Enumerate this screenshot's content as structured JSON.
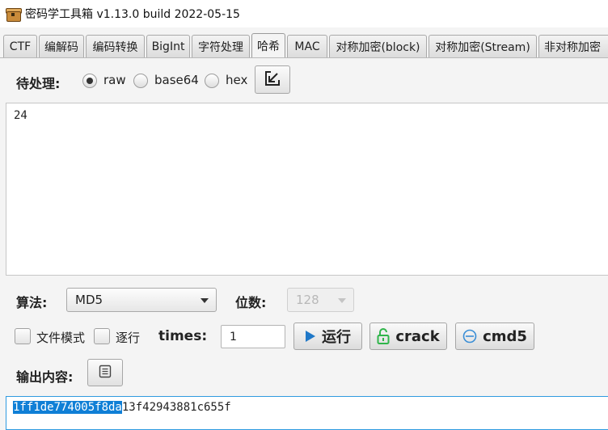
{
  "window": {
    "title": "密码学工具箱 v1.13.0 build 2022-05-15"
  },
  "tabs": [
    {
      "label": "CTF",
      "active": false
    },
    {
      "label": "编解码",
      "active": false
    },
    {
      "label": "编码转换",
      "active": false
    },
    {
      "label": "BigInt",
      "active": false
    },
    {
      "label": "字符处理",
      "active": false
    },
    {
      "label": "哈希",
      "active": true
    },
    {
      "label": "MAC",
      "active": false
    },
    {
      "label": "对称加密(block)",
      "active": false
    },
    {
      "label": "对称加密(Stream)",
      "active": false
    },
    {
      "label": "非对称加密",
      "active": false
    }
  ],
  "input": {
    "label": "待处理:",
    "encoding_options": [
      {
        "label": "raw",
        "checked": true
      },
      {
        "label": "base64",
        "checked": false
      },
      {
        "label": "hex",
        "checked": false
      }
    ],
    "content": "24"
  },
  "algo": {
    "label": "算法:",
    "selected": "MD5",
    "bits_label": "位数:",
    "bits_value": "128"
  },
  "options": {
    "file_mode_label": "文件模式",
    "line_by_line_label": "逐行",
    "times_label": "times:",
    "times_value": "1"
  },
  "actions": {
    "run_label": "运行",
    "crack_label": "crack",
    "cmd5_label": "cmd5"
  },
  "output": {
    "label": "输出内容:",
    "selected_part": "1ff1de774005f8da",
    "rest_part": "13f42943881c655f"
  },
  "colors": {
    "accent": "#2f9be0",
    "selection": "#0f7fd6",
    "run_icon": "#1f78c8",
    "crack_icon": "#2fb54a"
  }
}
